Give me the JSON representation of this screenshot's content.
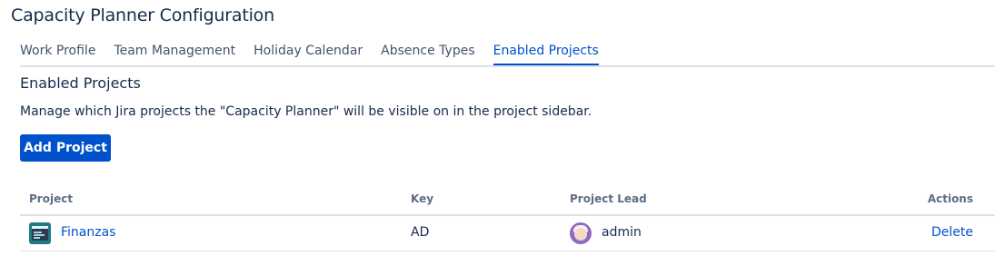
{
  "page": {
    "title": "Capacity Planner Configuration"
  },
  "tabs": [
    {
      "label": "Work Profile",
      "active": false
    },
    {
      "label": "Team Management",
      "active": false
    },
    {
      "label": "Holiday Calendar",
      "active": false
    },
    {
      "label": "Absence Types",
      "active": false
    },
    {
      "label": "Enabled Projects",
      "active": true
    }
  ],
  "section": {
    "title": "Enabled Projects",
    "description": "Manage which Jira projects the \"Capacity Planner\" will be visible on in the project sidebar.",
    "add_button_label": "Add Project"
  },
  "table": {
    "headers": {
      "project": "Project",
      "key": "Key",
      "lead": "Project Lead",
      "actions": "Actions"
    },
    "rows": [
      {
        "project": "Finanzas",
        "key": "AD",
        "lead": "admin",
        "action": "Delete"
      }
    ]
  },
  "colors": {
    "accent": "#0052cc",
    "text": "#172b4d",
    "border": "#dfe1e6"
  }
}
